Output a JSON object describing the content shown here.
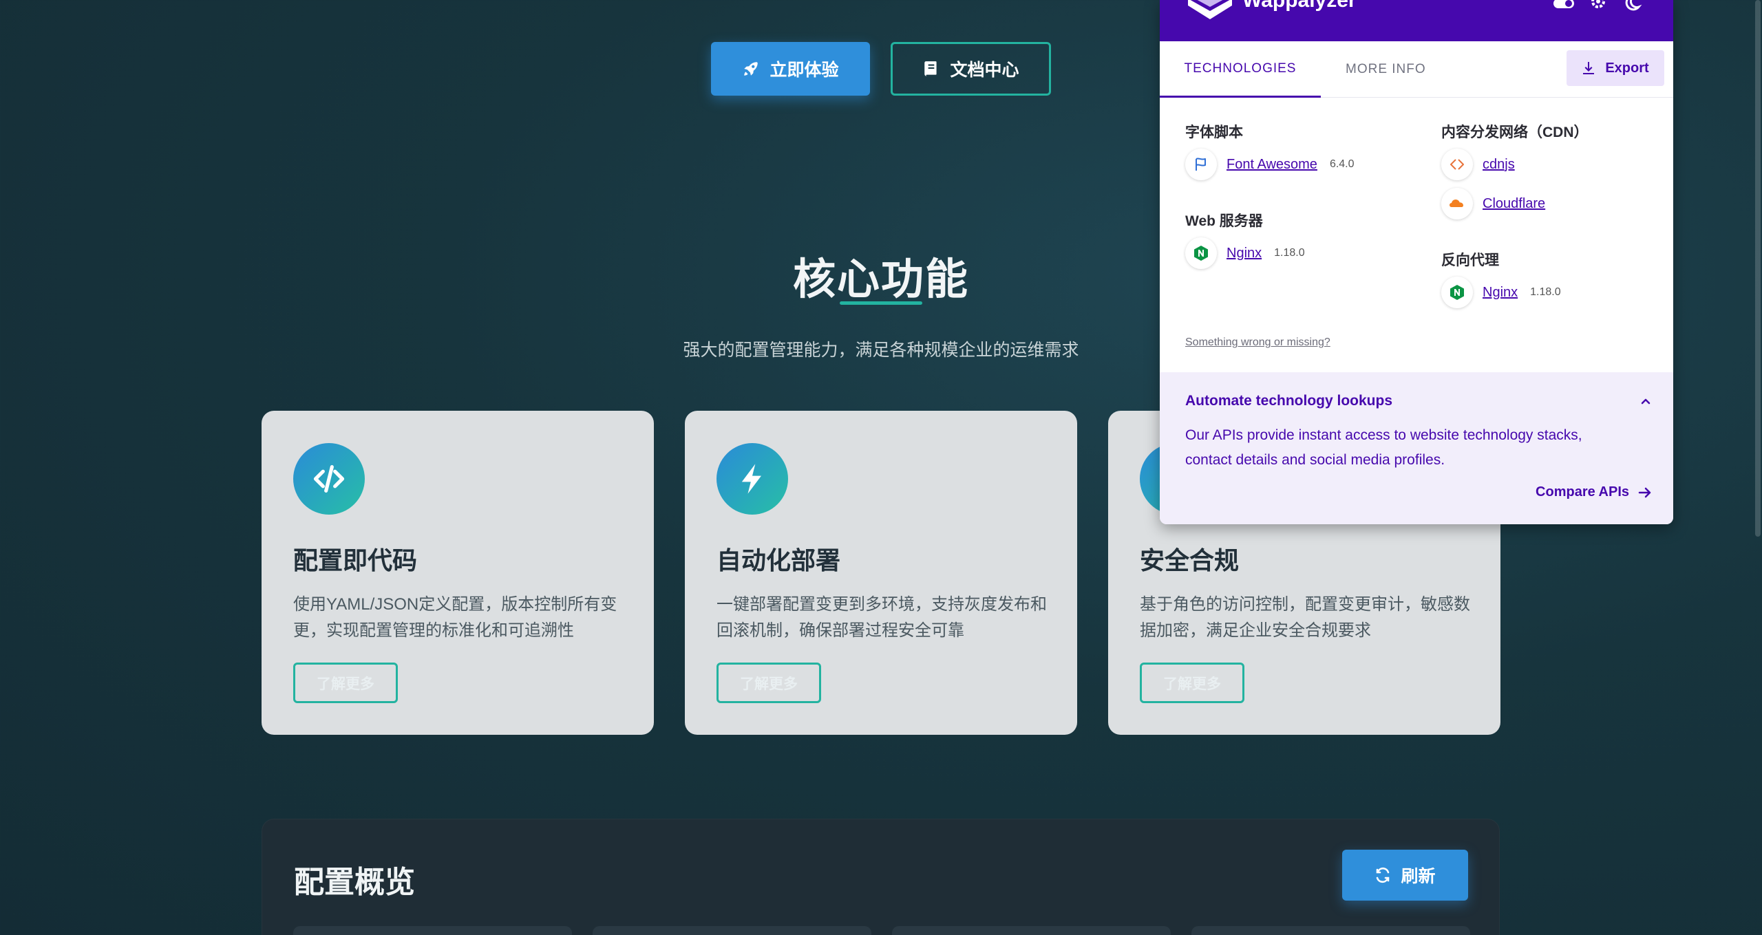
{
  "hero": {
    "primary_label": "立即体验",
    "secondary_label": "文档中心"
  },
  "features": {
    "title": "核心功能",
    "subtitle": "强大的配置管理能力，满足各种规模企业的运维需求",
    "cards": [
      {
        "icon": "code-icon",
        "title": "配置即代码",
        "desc": "使用YAML/JSON定义配置，版本控制所有变更，实现配置管理的标准化和可追溯性",
        "button": "了解更多"
      },
      {
        "icon": "bolt-icon",
        "title": "自动化部署",
        "desc": "一键部署配置变更到多环境，支持灰度发布和回滚机制，确保部署过程安全可靠",
        "button": "了解更多"
      },
      {
        "icon": "shield-icon",
        "title": "安全合规",
        "desc": "基于角色的访问控制，配置变更审计，敏感数据加密，满足企业安全合规要求",
        "button": "了解更多"
      }
    ]
  },
  "overview": {
    "title": "配置概览",
    "refresh_label": "刷新"
  },
  "wappalyzer": {
    "brand": "Wappalyzer",
    "tabs": [
      "TECHNOLOGIES",
      "MORE INFO"
    ],
    "export_label": "Export",
    "categories": {
      "font_scripts": {
        "title": "字体脚本",
        "items": [
          {
            "name": "Font Awesome",
            "version": "6.4.0",
            "icon": "font-awesome-flag-icon"
          }
        ]
      },
      "web_servers": {
        "title": "Web 服务器",
        "items": [
          {
            "name": "Nginx",
            "version": "1.18.0",
            "icon": "nginx-icon"
          }
        ]
      },
      "cdn": {
        "title": "内容分发网络（CDN）",
        "items": [
          {
            "name": "cdnjs",
            "version": "",
            "icon": "cdnjs-icon"
          },
          {
            "name": "Cloudflare",
            "version": "",
            "icon": "cloudflare-icon"
          }
        ]
      },
      "reverse_proxy": {
        "title": "反向代理",
        "items": [
          {
            "name": "Nginx",
            "version": "1.18.0",
            "icon": "nginx-icon"
          }
        ]
      }
    },
    "wrong_link": "Something wrong or missing?",
    "promo": {
      "title": "Automate technology lookups",
      "text": "Our APIs provide instant access to website technology stacks, contact details and social media profiles.",
      "link": "Compare APIs"
    }
  },
  "colors": {
    "primary_blue": "#2f8fdb",
    "teal": "#23b3a0",
    "wappalyzer_purple": "#4608ad"
  }
}
